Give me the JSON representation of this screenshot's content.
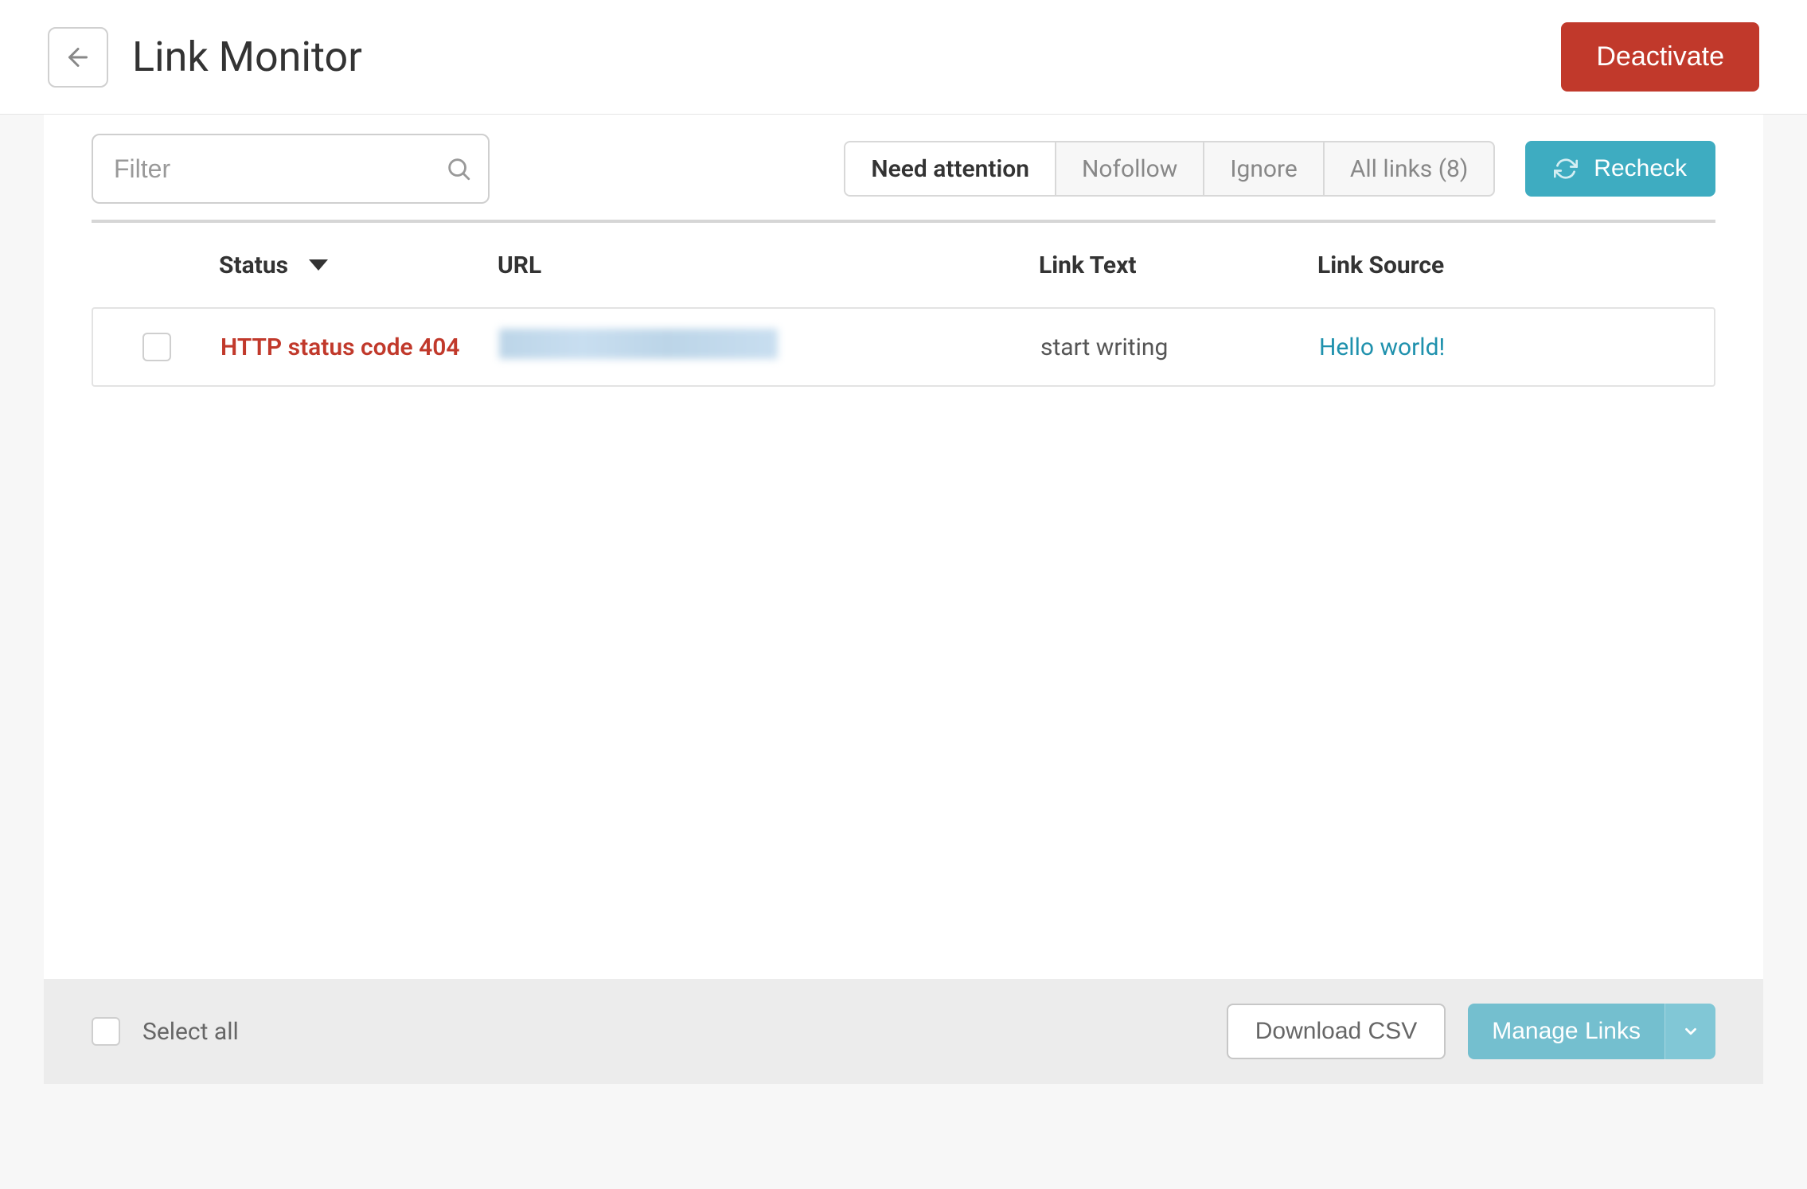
{
  "header": {
    "title": "Link Monitor",
    "deactivate_label": "Deactivate"
  },
  "toolbar": {
    "filter_placeholder": "Filter",
    "tabs": {
      "need_attention": "Need attention",
      "nofollow": "Nofollow",
      "ignore": "Ignore",
      "all_links": "All links (8)"
    },
    "recheck_label": "Recheck"
  },
  "table": {
    "columns": {
      "status": "Status",
      "url": "URL",
      "link_text": "Link Text",
      "link_source": "Link Source"
    },
    "rows": [
      {
        "status": "HTTP status code 404",
        "url": "",
        "link_text": "start writing",
        "link_source": "Hello world!"
      }
    ]
  },
  "footer": {
    "select_all_label": "Select all",
    "download_label": "Download CSV",
    "manage_label": "Manage Links"
  }
}
